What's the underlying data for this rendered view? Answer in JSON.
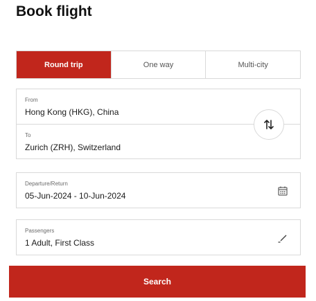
{
  "page": {
    "title": "Book flight"
  },
  "trip_tabs": [
    {
      "label": "Round trip",
      "active": true
    },
    {
      "label": "One way",
      "active": false
    },
    {
      "label": "Multi-city",
      "active": false
    }
  ],
  "route": {
    "from": {
      "label": "From",
      "value": "Hong Kong (HKG), China"
    },
    "to": {
      "label": "To",
      "value": "Zurich (ZRH), Switzerland"
    },
    "swap_icon": "swap-vertical-icon"
  },
  "dates": {
    "label": "Departure/Return",
    "value": "05-Jun-2024 - 10-Jun-2024",
    "icon": "calendar-icon"
  },
  "passengers": {
    "label": "Passengers",
    "value": "1 Adult, First Class",
    "icon": "pencil-icon"
  },
  "search": {
    "label": "Search"
  },
  "colors": {
    "accent": "#c1261c",
    "border": "#d9d9d9"
  }
}
